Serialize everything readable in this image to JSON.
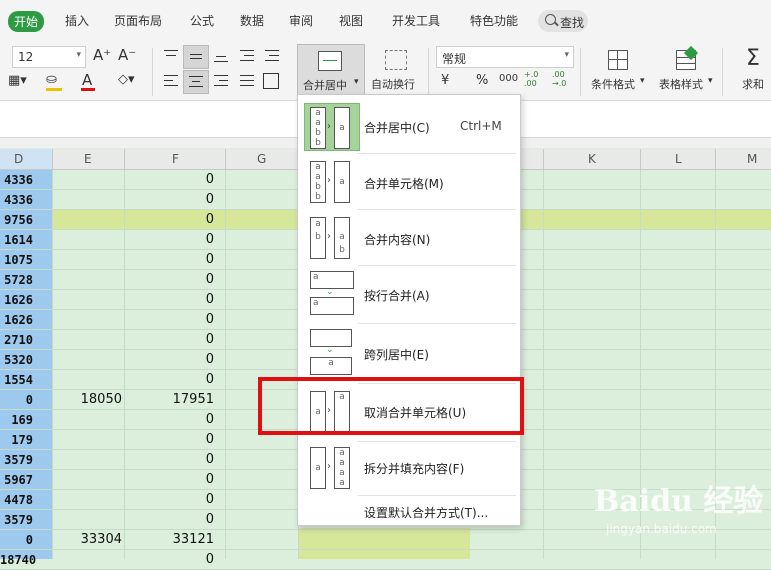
{
  "tabs": [
    {
      "label": "开始",
      "active": true
    },
    {
      "label": "插入"
    },
    {
      "label": "页面布局"
    },
    {
      "label": "公式"
    },
    {
      "label": "数据"
    },
    {
      "label": "审阅"
    },
    {
      "label": "视图"
    },
    {
      "label": "开发工具"
    },
    {
      "label": "特色功能"
    }
  ],
  "search": {
    "label": "查找"
  },
  "ribbon": {
    "font_size": "12",
    "number_format": "常规",
    "merge_center_label": "合并居中",
    "wrap_label": "自动换行",
    "cond_format_label": "条件格式",
    "table_style_label": "表格样式",
    "sum_label": "求和",
    "currency_symbol": "¥",
    "percent_symbol": "%",
    "thousands_symbol": "000",
    "inc_decimal": "+.0 .00",
    "dec_decimal": ".00 →.0",
    "font_color_letter": "A",
    "grow_font": "A⁺",
    "shrink_font": "A⁻"
  },
  "columns": [
    "D",
    "E",
    "F",
    "G",
    "K",
    "L",
    "M"
  ],
  "rows": [
    {
      "d": "4336",
      "e": "",
      "f": "0"
    },
    {
      "d": "4336",
      "e": "",
      "f": "0"
    },
    {
      "d": "9756",
      "e": "",
      "f": "0"
    },
    {
      "d": "1614",
      "e": "",
      "f": "0"
    },
    {
      "d": "1075",
      "e": "",
      "f": "0"
    },
    {
      "d": "5728",
      "e": "",
      "f": "0"
    },
    {
      "d": "1626",
      "e": "",
      "f": "0"
    },
    {
      "d": "1626",
      "e": "",
      "f": "0"
    },
    {
      "d": "2710",
      "e": "",
      "f": "0"
    },
    {
      "d": "5320",
      "e": "",
      "f": "0"
    },
    {
      "d": "1554",
      "e": "",
      "f": "0"
    },
    {
      "d": "0",
      "e": "18050",
      "f": "17951"
    },
    {
      "d": "169",
      "e": "",
      "f": "0"
    },
    {
      "d": "179",
      "e": "",
      "f": "0"
    },
    {
      "d": "3579",
      "e": "",
      "f": "0"
    },
    {
      "d": "5967",
      "e": "",
      "f": "0"
    },
    {
      "d": "4478",
      "e": "",
      "f": "0"
    },
    {
      "d": "3579",
      "e": "",
      "f": "0"
    },
    {
      "d": "0",
      "e": "33304",
      "f": "33121"
    },
    {
      "d": "18740",
      "e": "",
      "f": "0"
    }
  ],
  "dropdown": {
    "items": [
      {
        "label": "合并居中(C)",
        "shortcut": "Ctrl+M"
      },
      {
        "label": "合并单元格(M)"
      },
      {
        "label": "合并内容(N)"
      },
      {
        "label": "按行合并(A)"
      },
      {
        "label": "跨列居中(E)"
      },
      {
        "label": "取消合并单元格(U)"
      },
      {
        "label": "拆分并填充内容(F)"
      },
      {
        "label": "设置默认合并方式(T)..."
      }
    ],
    "icon_letters": {
      "a": "a",
      "b": "b"
    }
  },
  "watermark": {
    "brand": "Baidu 经验",
    "url": "jingyan.baidu.com"
  },
  "colors": {
    "accent": "#2e9a43",
    "highlight": "#e01010",
    "sheet_bg": "#dcefdc",
    "selected_col": "#9ec9ee",
    "row_highlight": "#d6e79a"
  }
}
